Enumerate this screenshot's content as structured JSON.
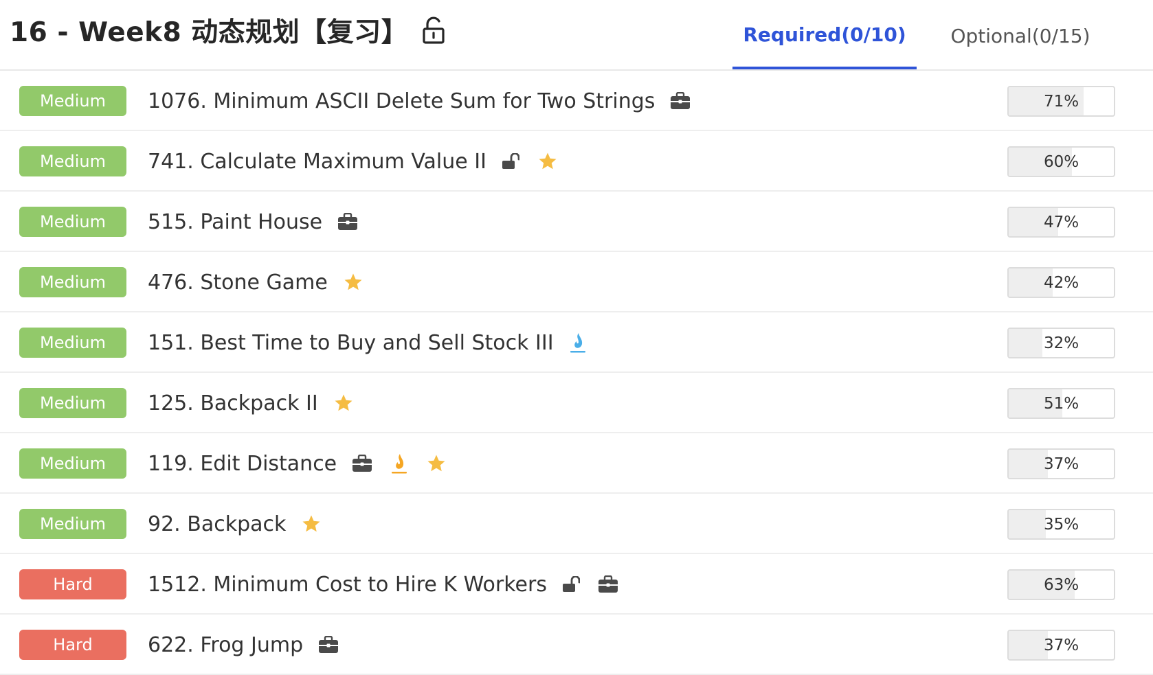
{
  "header": {
    "title": "16 - Week8 动态规划【复习】",
    "title_icon": "unlock-icon"
  },
  "tabs": [
    {
      "label": "Required(0/10)",
      "active": true
    },
    {
      "label": "Optional(0/15)",
      "active": false
    }
  ],
  "colors": {
    "accent": "#2f54d8",
    "medium": "#92c96a",
    "hard": "#ea6f60",
    "star": "#f5bc42",
    "flame_blue": "#4aaee8",
    "flame_orange": "#f5a623"
  },
  "problems": [
    {
      "difficulty": "Medium",
      "title": "1076. Minimum ASCII Delete Sum for Two Strings",
      "icons": [
        "briefcase-icon"
      ],
      "progress": "71%",
      "progress_value": 71
    },
    {
      "difficulty": "Medium",
      "title": "741. Calculate Maximum Value II",
      "icons": [
        "unlock-icon",
        "star-icon"
      ],
      "progress": "60%",
      "progress_value": 60
    },
    {
      "difficulty": "Medium",
      "title": "515. Paint House",
      "icons": [
        "briefcase-icon"
      ],
      "progress": "47%",
      "progress_value": 47
    },
    {
      "difficulty": "Medium",
      "title": "476. Stone Game",
      "icons": [
        "star-icon"
      ],
      "progress": "42%",
      "progress_value": 42
    },
    {
      "difficulty": "Medium",
      "title": "151. Best Time to Buy and Sell Stock III",
      "icons": [
        "flame-blue-icon"
      ],
      "progress": "32%",
      "progress_value": 32
    },
    {
      "difficulty": "Medium",
      "title": "125. Backpack II",
      "icons": [
        "star-icon"
      ],
      "progress": "51%",
      "progress_value": 51
    },
    {
      "difficulty": "Medium",
      "title": "119. Edit Distance",
      "icons": [
        "briefcase-icon",
        "flame-orange-icon",
        "star-icon"
      ],
      "progress": "37%",
      "progress_value": 37
    },
    {
      "difficulty": "Medium",
      "title": "92. Backpack",
      "icons": [
        "star-icon"
      ],
      "progress": "35%",
      "progress_value": 35
    },
    {
      "difficulty": "Hard",
      "title": "1512. Minimum Cost to Hire K Workers",
      "icons": [
        "unlock-icon",
        "briefcase-icon"
      ],
      "progress": "63%",
      "progress_value": 63
    },
    {
      "difficulty": "Hard",
      "title": "622. Frog Jump",
      "icons": [
        "briefcase-icon"
      ],
      "progress": "37%",
      "progress_value": 37
    }
  ]
}
